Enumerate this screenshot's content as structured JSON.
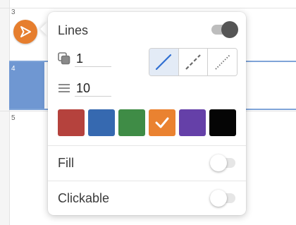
{
  "rows": [
    {
      "number": "3"
    },
    {
      "number": "4"
    },
    {
      "number": "5"
    }
  ],
  "item_icon": {
    "icon": "play-triangle-icon",
    "color": "#e67e2e"
  },
  "popup": {
    "lines_label": "Lines",
    "lines_toggle_on": true,
    "opacity_value": "1",
    "thickness_value": "10",
    "line_styles": [
      {
        "name": "solid",
        "selected": true
      },
      {
        "name": "dashed",
        "selected": false
      },
      {
        "name": "dotted",
        "selected": false
      }
    ],
    "colors": [
      {
        "hex": "#b5423d",
        "selected": false
      },
      {
        "hex": "#3669b0",
        "selected": false
      },
      {
        "hex": "#3f8c46",
        "selected": false
      },
      {
        "hex": "#ea8230",
        "selected": true
      },
      {
        "hex": "#6540a8",
        "selected": false
      },
      {
        "hex": "#050505",
        "selected": false
      }
    ],
    "fill_label": "Fill",
    "fill_toggle_on": false,
    "clickable_label": "Clickable",
    "clickable_toggle_on": false
  },
  "accent": "#2f6fd1"
}
